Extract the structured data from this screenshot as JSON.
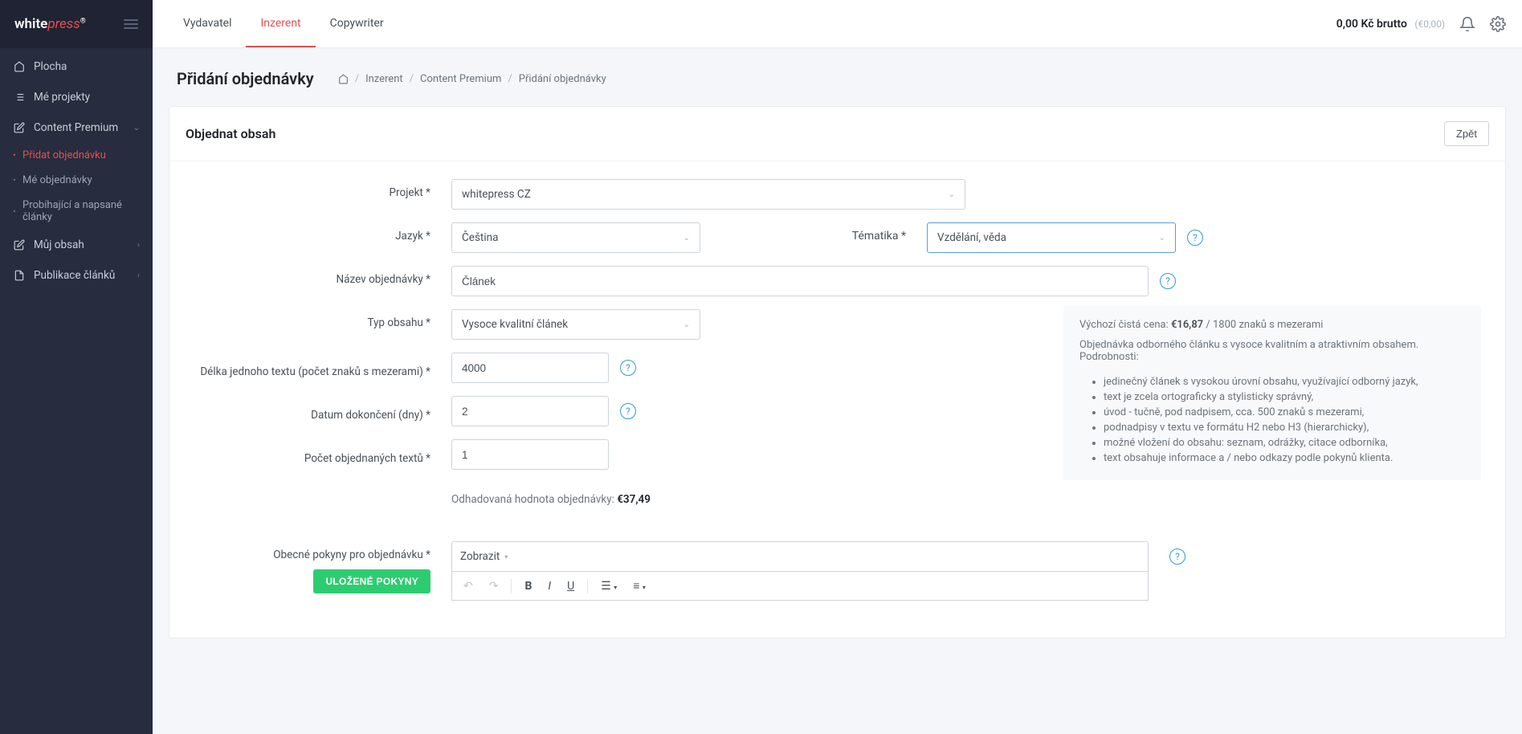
{
  "logo": {
    "white": "white",
    "press": "press",
    "reg": "®"
  },
  "sidebar": {
    "items": [
      {
        "label": "Plocha"
      },
      {
        "label": "Mé projekty"
      },
      {
        "label": "Content Premium"
      },
      {
        "label": "Můj obsah"
      },
      {
        "label": "Publikace článků"
      }
    ],
    "sub": [
      {
        "label": "Přidat objednávku"
      },
      {
        "label": "Mé objednávky"
      },
      {
        "label": "Probíhající a napsané články"
      }
    ]
  },
  "topnav": [
    {
      "label": "Vydavatel"
    },
    {
      "label": "Inzerent"
    },
    {
      "label": "Copywriter"
    }
  ],
  "balance": {
    "main": "0,00 Kč brutto",
    "sub": "(€0,00)"
  },
  "page": {
    "title": "Přidání objednávky",
    "crumbs": [
      "Inzerent",
      "Content Premium",
      "Přidání objednávky"
    ]
  },
  "card": {
    "title": "Objednat obsah",
    "back": "Zpět"
  },
  "form": {
    "project_label": "Projekt *",
    "project_value": "whitepress CZ",
    "lang_label": "Jazyk *",
    "lang_value": "Čeština",
    "topic_label": "Tématika *",
    "topic_value": "Vzdělání, věda",
    "name_label": "Název objednávky *",
    "name_value": "Článek",
    "type_label": "Typ obsahu *",
    "type_value": "Vysoce kvalitní článek",
    "length_label": "Délka jednoho textu (počet znaků s mezerami) *",
    "length_value": "4000",
    "deadline_label": "Datum dokončení (dny) *",
    "deadline_value": "2",
    "count_label": "Počet objednaných textů *",
    "count_value": "1",
    "est_label": "Odhadovaná hodnota objednávky: ",
    "est_value": "€37,49",
    "instr_label": "Obecné pokyny pro objednávku *",
    "saved_btn": "ULOŽENÉ POKYNY",
    "editor_show": "Zobrazit"
  },
  "info": {
    "line1_a": "Výchozí čistá cena: ",
    "line1_b": "€16,87",
    "line1_c": " / 1800 znaků s mezerami",
    "line2": "Objednávka odborného článku s vysoce kvalitním a atraktivním obsahem. Podrobnosti:",
    "bullets": [
      "jedinečný článek s vysokou úrovní obsahu, využívající odborný jazyk,",
      "text je zcela ortograficky a stylisticky správný,",
      "úvod - tučně, pod nadpisem, cca. 500 znaků s mezerami,",
      "podnadpisy v textu ve formátu H2 nebo H3 (hierarchicky),",
      "možné vložení do obsahu: seznam, odrážky, citace odborníka,",
      "text obsahuje informace a / nebo odkazy podle pokynů klienta."
    ]
  }
}
